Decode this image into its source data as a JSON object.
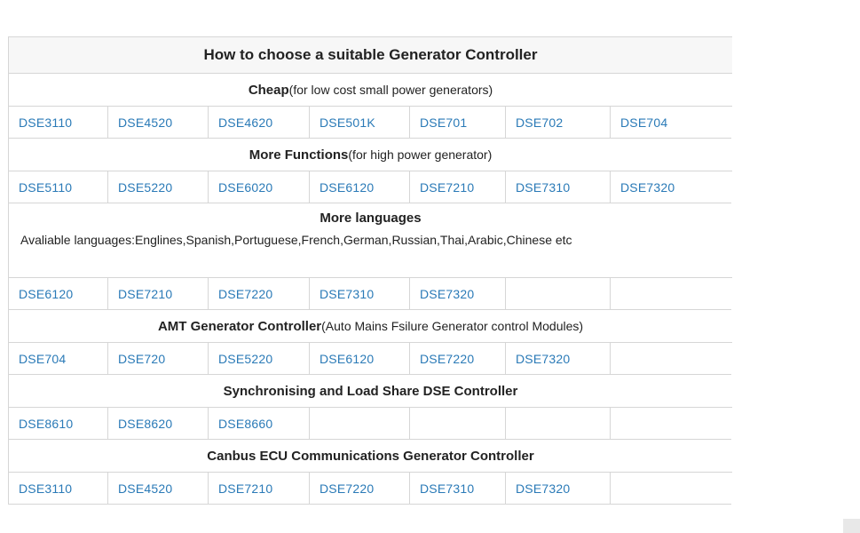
{
  "table": {
    "title": "How to choose a suitable Generator Controller",
    "sections": [
      {
        "heading": "Cheap",
        "note": "(for low cost small power generators)",
        "models": [
          "DSE3110",
          "DSE4520",
          "DSE4620",
          "DSE501K",
          "DSE701",
          "DSE702",
          "DSE704"
        ]
      },
      {
        "heading": "More Functions",
        "note": "(for high power generator)",
        "models": [
          "DSE5110",
          "DSE5220",
          "DSE6020",
          "DSE6120",
          "DSE7210",
          "DSE7310",
          "DSE7320"
        ]
      },
      {
        "heading": "More languages",
        "description": "Avaliable languages:Englines,Spanish,Portuguese,French,German,Russian,Thai,Arabic,Chinese etc",
        "models": [
          "DSE6120",
          "DSE7210",
          "DSE7220",
          "DSE7310",
          "DSE7320",
          "",
          ""
        ]
      },
      {
        "heading": "AMT Generator Controller",
        "note": "(Auto Mains Fsilure Generator control Modules)",
        "models": [
          "DSE704",
          "DSE720",
          "DSE5220",
          "DSE6120",
          "DSE7220",
          "DSE7320",
          ""
        ]
      },
      {
        "heading": "Synchronising and Load Share DSE Controller",
        "note": "",
        "models": [
          "DSE8610",
          "DSE8620",
          "DSE8660",
          "",
          "",
          "",
          ""
        ]
      },
      {
        "heading": "Canbus ECU Communications Generator Controller",
        "note": "",
        "models": [
          "DSE3110",
          "DSE4520",
          "DSE7210",
          "DSE7220",
          "DSE7310",
          "DSE7320",
          ""
        ]
      }
    ]
  },
  "colors": {
    "link": "#2a7ab7",
    "border": "#d6d6d6",
    "header_bg": "#f7f7f7"
  }
}
